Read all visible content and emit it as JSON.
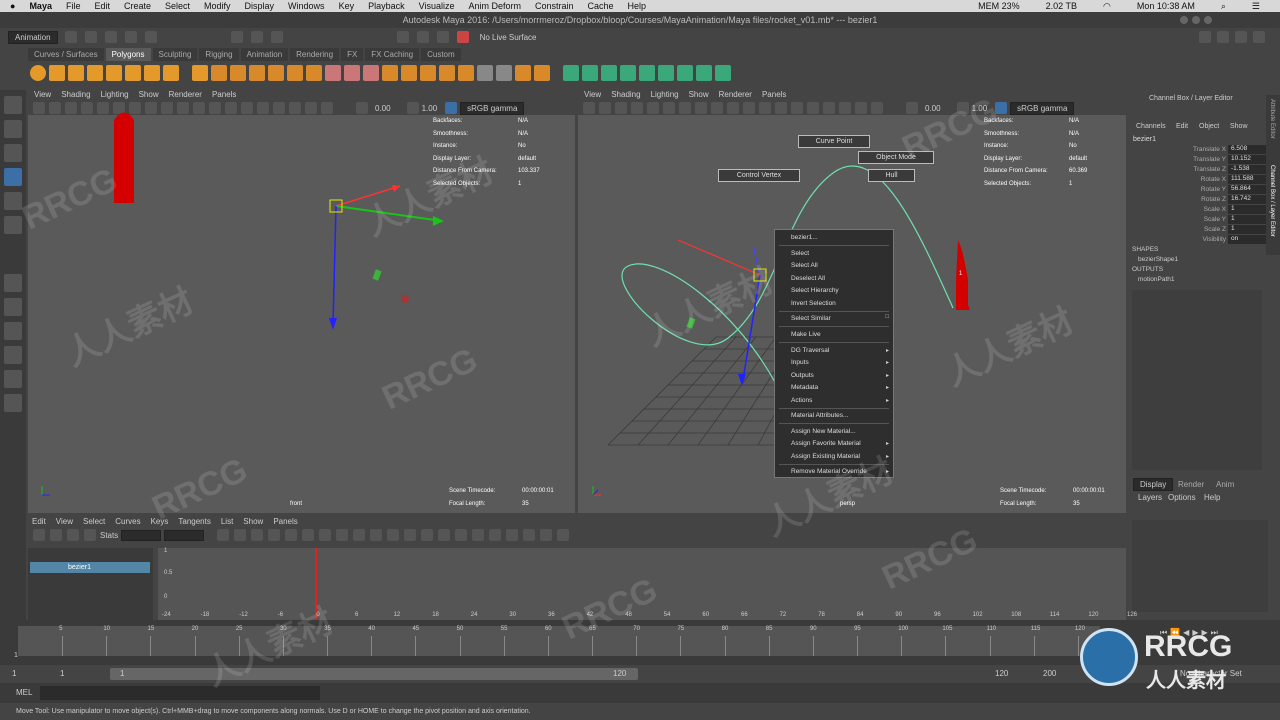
{
  "mac": {
    "app": "Maya",
    "menus": [
      "File",
      "Edit",
      "Create",
      "Select",
      "Modify",
      "Display",
      "Windows",
      "Key",
      "Playback",
      "Visualize",
      "Anim Deform",
      "Constrain",
      "Cache",
      "Help"
    ],
    "mem": "MEM 23%",
    "disk": "2.02 TB",
    "clock": "Mon 10:38 AM"
  },
  "window": {
    "title": "Autodesk Maya 2016: /Users/morrmeroz/Dropbox/bloop/Courses/MayaAnimation/Maya files/rocket_v01.mb*  ---  bezier1"
  },
  "status": {
    "menuset": "Animation",
    "live_surface": "No Live Surface"
  },
  "shelf": {
    "tabs": [
      "Curves / Surfaces",
      "Polygons",
      "Sculpting",
      "Rigging",
      "Animation",
      "Rendering",
      "FX",
      "FX Caching",
      "Custom"
    ],
    "active": "Polygons"
  },
  "viewport_menu": [
    "View",
    "Shading",
    "Lighting",
    "Show",
    "Renderer",
    "Panels"
  ],
  "vp_left": {
    "exposure": "0.00",
    "gamma": "1.00",
    "colorspace": "sRGB gamma",
    "camera": "front",
    "hud_labels": [
      "Backfaces:",
      "Smoothness:",
      "Instance:",
      "Display Layer:",
      "Distance From Camera:",
      "Selected Objects:"
    ],
    "hud_values": [
      "N/A",
      "N/A",
      "No",
      "default",
      "103.337",
      "1"
    ],
    "timecode_label": "Scene Timecode:",
    "timecode": "00:00:00:01",
    "focal_label": "Focal Length:",
    "focal": "35"
  },
  "vp_right": {
    "exposure": "0.00",
    "gamma": "1.00",
    "colorspace": "sRGB gamma",
    "camera": "persp",
    "hud_labels": [
      "Backfaces:",
      "Smoothness:",
      "Instance:",
      "Display Layer:",
      "Distance From Camera:",
      "Selected Objects:"
    ],
    "hud_values": [
      "N/A",
      "N/A",
      "No",
      "default",
      "60.369",
      "1"
    ],
    "timecode_label": "Scene Timecode:",
    "timecode": "00:00:00:01",
    "focal_label": "Focal Length:",
    "focal": "35"
  },
  "hotbox": {
    "curve_point": "Curve Point",
    "object_mode": "Object Mode",
    "control_vertex": "Control Vertex",
    "hull": "Hull"
  },
  "context_menu": {
    "header": "bezier1...",
    "items": [
      "Select",
      "Select All",
      "Deselect All",
      "Select Hierarchy",
      "Invert Selection",
      "Select Similar",
      "Make Live",
      "DG Traversal",
      "Inputs",
      "Outputs",
      "Metadata",
      "Actions",
      "Material Attributes...",
      "Assign New Material...",
      "Assign Favorite Material",
      "Assign Existing Material",
      "Remove Material Override"
    ]
  },
  "channel_box": {
    "title": "Channel Box / Layer Editor",
    "menus": [
      "Channels",
      "Edit",
      "Object",
      "Show"
    ],
    "object": "bezier1",
    "attrs": [
      {
        "name": "Translate X",
        "value": "6.508"
      },
      {
        "name": "Translate Y",
        "value": "10.152"
      },
      {
        "name": "Translate Z",
        "value": "-1.538"
      },
      {
        "name": "Rotate X",
        "value": "111.588"
      },
      {
        "name": "Rotate Y",
        "value": "56.864"
      },
      {
        "name": "Rotate Z",
        "value": "16.742"
      },
      {
        "name": "Scale X",
        "value": "1"
      },
      {
        "name": "Scale Y",
        "value": "1"
      },
      {
        "name": "Scale Z",
        "value": "1"
      },
      {
        "name": "Visibility",
        "value": "on"
      }
    ],
    "shapes_label": "SHAPES",
    "shape": "bezierShape1",
    "outputs_label": "OUTPUTS",
    "output": "motionPath1",
    "side_tabs": [
      "Attribute Editor",
      "Channel Box / Layer Editor"
    ]
  },
  "layer_editor": {
    "tabs": [
      "Display",
      "Render",
      "Anim"
    ],
    "menus": [
      "Layers",
      "Options",
      "Help"
    ]
  },
  "graph_editor": {
    "menus": [
      "Edit",
      "View",
      "Select",
      "Curves",
      "Keys",
      "Tangents",
      "List",
      "Show",
      "Panels"
    ],
    "stats": "Stats",
    "outliner_item": "bezier1",
    "y_ticks": [
      "1",
      "0.5",
      "0"
    ],
    "x_ticks": [
      "-24",
      "-18",
      "-12",
      "-6",
      "0",
      "6",
      "12",
      "18",
      "24",
      "30",
      "36",
      "42",
      "48",
      "54",
      "60",
      "66",
      "72",
      "78",
      "84",
      "90",
      "96",
      "102",
      "108",
      "114",
      "120",
      "126"
    ]
  },
  "timeline": {
    "ticks": [
      "5",
      "10",
      "15",
      "20",
      "25",
      "30",
      "35",
      "40",
      "45",
      "50",
      "55",
      "60",
      "65",
      "70",
      "75",
      "80",
      "85",
      "90",
      "95",
      "100",
      "105",
      "110",
      "115",
      "120"
    ],
    "current": "1"
  },
  "range": {
    "start": "1",
    "inner_start": "1",
    "slider_start": "1",
    "slider_end": "120",
    "end": "120",
    "anim_end": "200",
    "character": "No Character Set"
  },
  "mel": {
    "label": "MEL"
  },
  "help": {
    "text": "Move Tool: Use manipulator to move object(s). Ctrl+MMB+drag to move components along normals. Use D or HOME to change the pivot position and axis orientation."
  },
  "watermark": {
    "brand": "RRCG",
    "cn": "人人素材"
  },
  "colors": {
    "rocket": "#d40000",
    "curve": "#6fe0b0",
    "selection": "#e6e600"
  }
}
